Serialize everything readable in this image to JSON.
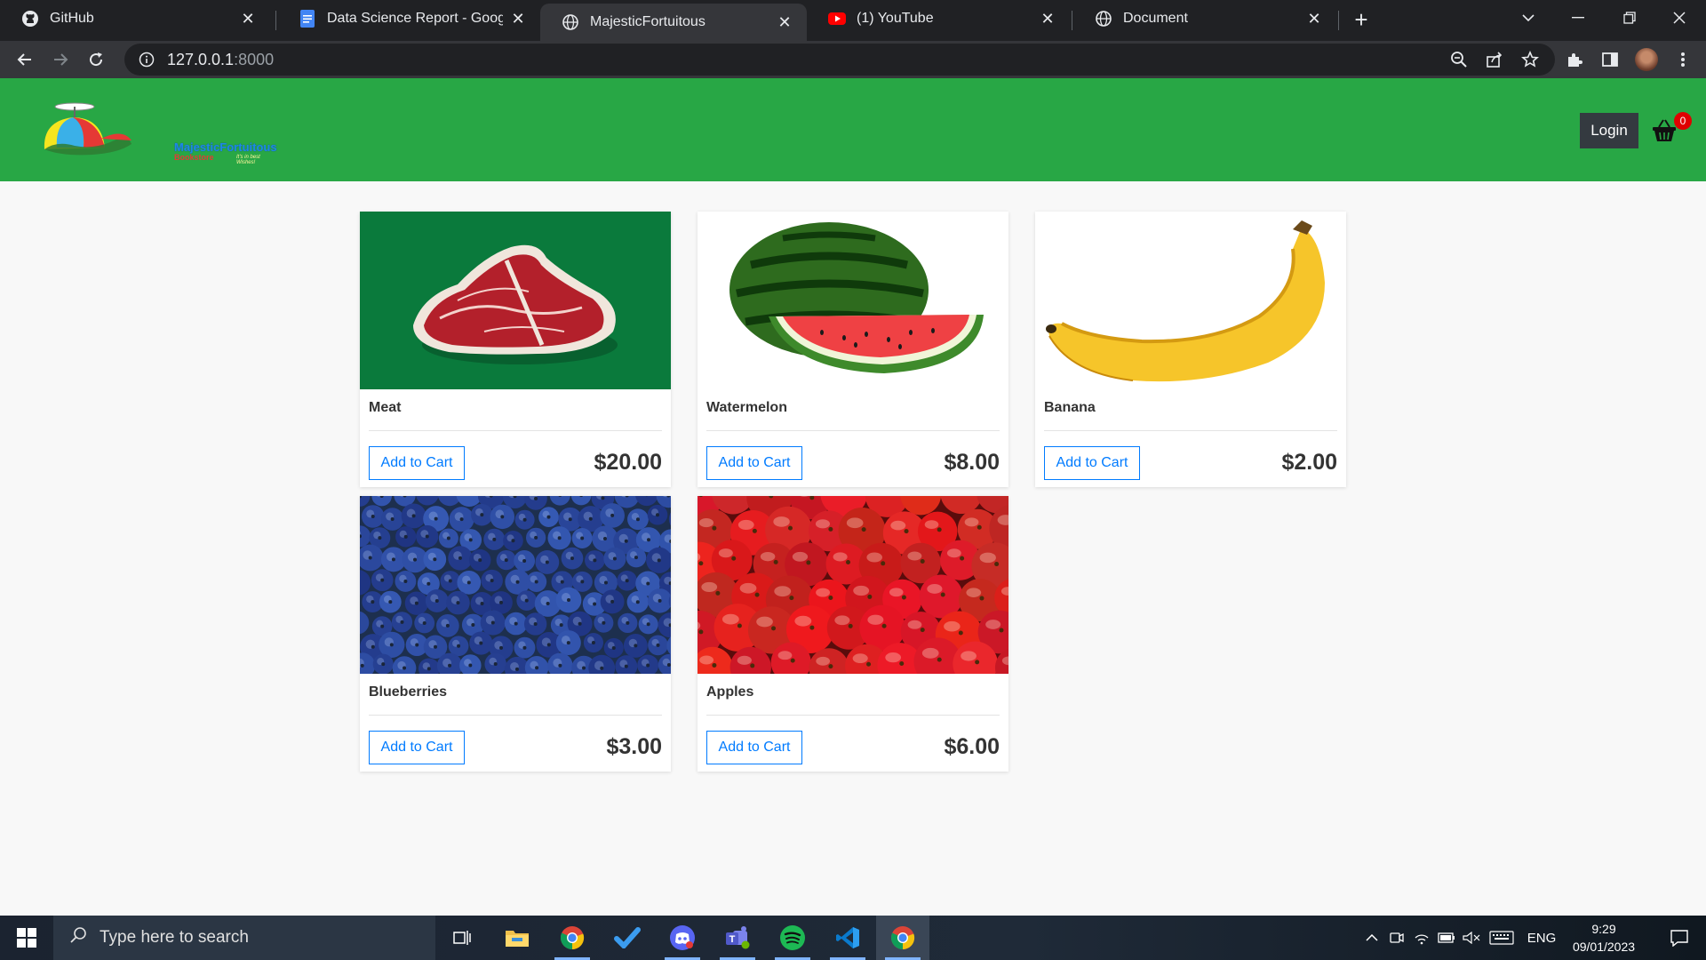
{
  "browser": {
    "tabs": [
      {
        "title": "GitHub",
        "icon": "github-icon"
      },
      {
        "title": "Data Science Report - Google Docs",
        "icon": "google-docs-icon"
      },
      {
        "title": "MajesticFortuitous",
        "icon": "globe-icon",
        "active": true
      },
      {
        "title": "(1) YouTube",
        "icon": "youtube-icon"
      },
      {
        "title": "Document",
        "icon": "globe-icon"
      }
    ],
    "address": {
      "host": "127.0.0.1",
      "port": ":8000"
    }
  },
  "site": {
    "logo": {
      "name": "MajesticFortuitous",
      "sub": "Bookstore",
      "tagline": "It's in best Wishes!"
    },
    "login_label": "Login",
    "cart_count": "0"
  },
  "products": [
    {
      "name": "Meat",
      "price": "$20.00",
      "button": "Add to Cart",
      "image": "meat"
    },
    {
      "name": "Watermelon",
      "price": "$8.00",
      "button": "Add to Cart",
      "image": "watermelon"
    },
    {
      "name": "Banana",
      "price": "$2.00",
      "button": "Add to Cart",
      "image": "banana"
    },
    {
      "name": "Blueberries",
      "price": "$3.00",
      "button": "Add to Cart",
      "image": "blueberries"
    },
    {
      "name": "Apples",
      "price": "$6.00",
      "button": "Add to Cart",
      "image": "apples"
    }
  ],
  "taskbar": {
    "search_placeholder": "Type here to search",
    "apps": [
      "task-view-icon",
      "file-explorer-icon",
      "chrome-icon",
      "todo-icon",
      "discord-icon",
      "teams-icon",
      "spotify-icon",
      "vscode-icon",
      "chrome-icon"
    ],
    "language": "ENG",
    "time": "9:29",
    "date": "09/01/2023"
  },
  "colors": {
    "header_green": "#28a745",
    "button_blue": "#007bff",
    "login_dark": "#343a40",
    "badge_red": "#e00000"
  }
}
